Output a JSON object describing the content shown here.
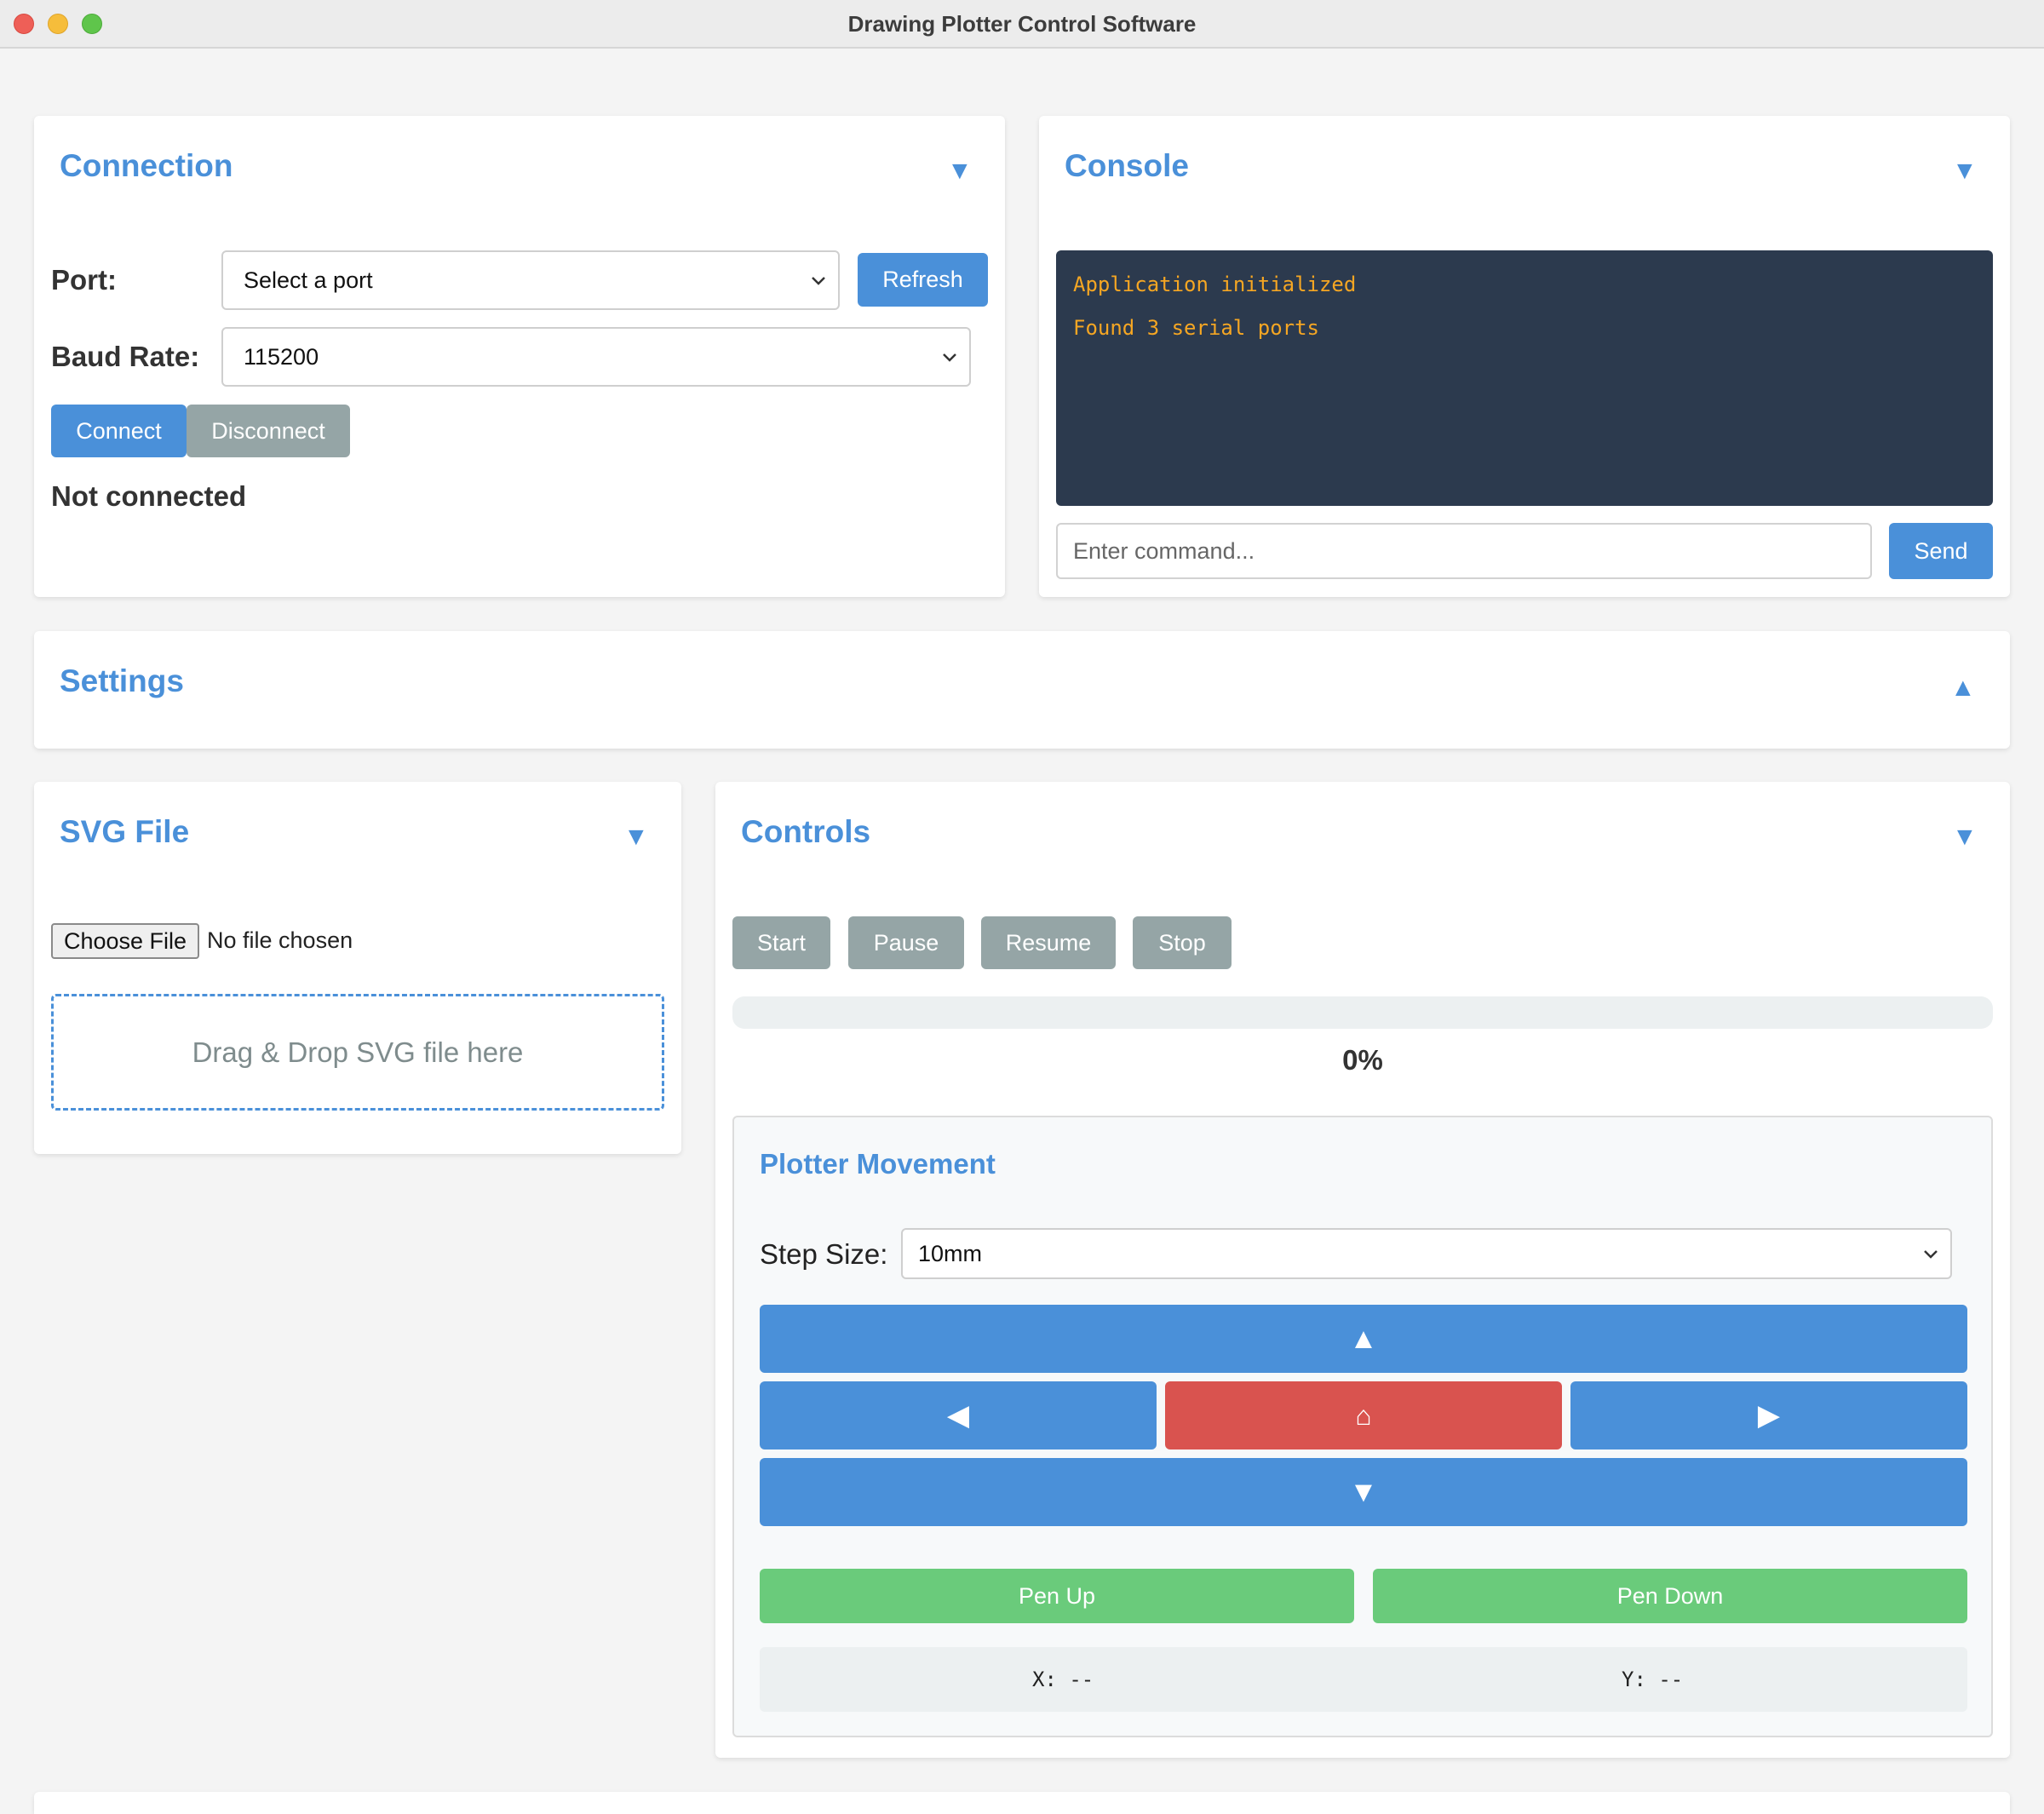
{
  "window": {
    "title": "Drawing Plotter Control Software"
  },
  "connection": {
    "title": "Connection",
    "toggle": "▼",
    "port_label": "Port:",
    "port_value": "Select a port",
    "refresh_label": "Refresh",
    "baud_label": "Baud Rate:",
    "baud_value": "115200",
    "connect_label": "Connect",
    "disconnect_label": "Disconnect",
    "status": "Not connected"
  },
  "console": {
    "title": "Console",
    "toggle": "▼",
    "lines": [
      "Application initialized",
      "Found 3 serial ports"
    ],
    "input_placeholder": "Enter command...",
    "send_label": "Send"
  },
  "settings": {
    "title": "Settings",
    "toggle": "▲"
  },
  "svg_file": {
    "title": "SVG File",
    "toggle": "▼",
    "choose_label": "Choose File",
    "file_status": "No file chosen",
    "dropzone_text": "Drag & Drop SVG file here"
  },
  "controls": {
    "title": "Controls",
    "toggle": "▼",
    "start_label": "Start",
    "pause_label": "Pause",
    "resume_label": "Resume",
    "stop_label": "Stop",
    "progress": 0,
    "progress_text": "0%"
  },
  "movement": {
    "title": "Plotter Movement",
    "step_label": "Step Size:",
    "step_value": "10mm",
    "up_label": "▲",
    "left_label": "◀",
    "home_label": "⌂",
    "right_label": "▶",
    "down_label": "▼",
    "pen_up_label": "Pen Up",
    "pen_down_label": "Pen Down",
    "x_text": "X: --",
    "y_text": "Y: --"
  },
  "colors": {
    "accent": "#4a90d9",
    "grey_button": "#95a5a6",
    "home_button": "#d9534f",
    "pen_button": "#6acb7b",
    "console_bg": "#2c3a4e",
    "console_text": "#f5a623"
  }
}
